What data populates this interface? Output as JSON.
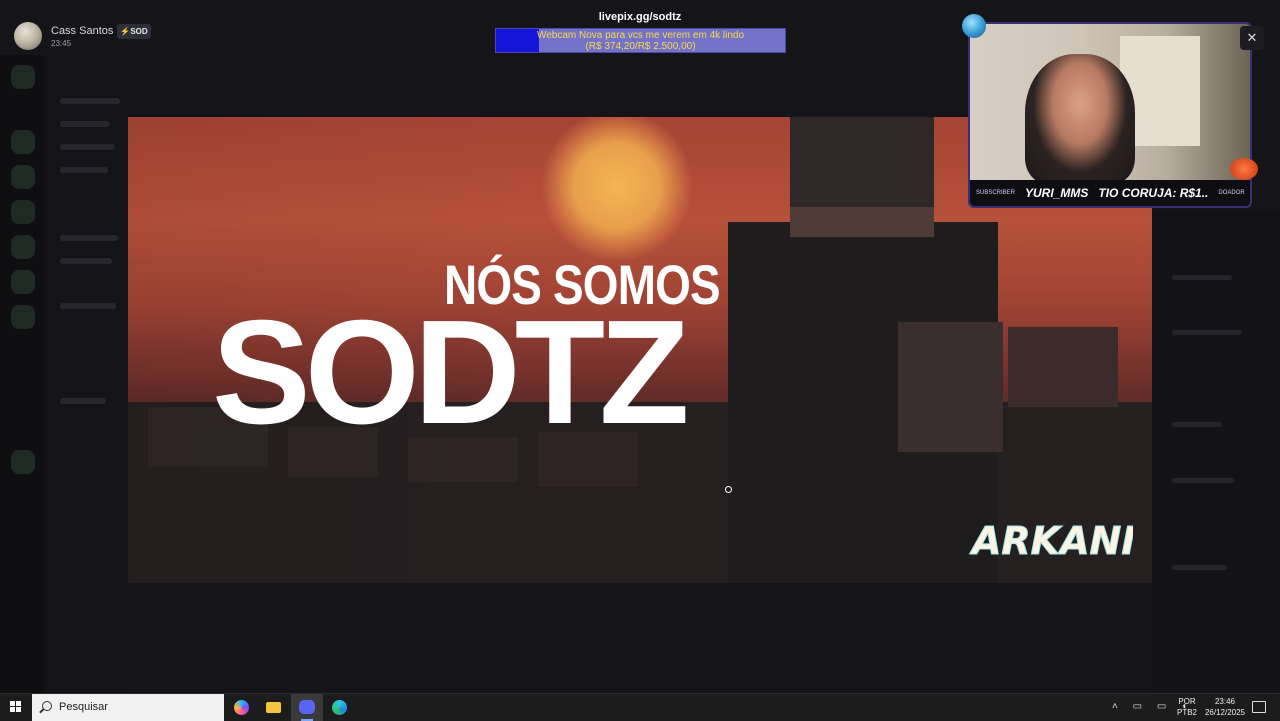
{
  "user": {
    "name": "Cass Santos",
    "badge": "⚡SOD",
    "time": "23:45"
  },
  "livepix": {
    "url": "livepix.gg/sodtz",
    "goal_title": "Webcam Nova para vcs me verem em 4k lindo",
    "goal_amount": "(R$ 374,20/R$ 2.500,00)",
    "progress": 0.15
  },
  "video": {
    "line1": "NÓS SOMOS",
    "line2": "SODTZ",
    "logo_text": "ARKANIS"
  },
  "webcam": {
    "subscriber_label": "SUBSCRIBER",
    "name1": "YURI_MMS",
    "name2": "TIO CORUJA: R$1..",
    "donate_label": "DOADOR"
  },
  "taskbar": {
    "search_placeholder": "Pesquisar",
    "lang_line1": "POR",
    "lang_line2": "PTB2",
    "time": "23:46",
    "date": "26/12/2025"
  },
  "colors": {
    "livepix_fill": "#1515d8",
    "livepix_bg": "#7272c8",
    "livepix_text": "#ffd84a",
    "cam_border": "#3a2f74"
  }
}
